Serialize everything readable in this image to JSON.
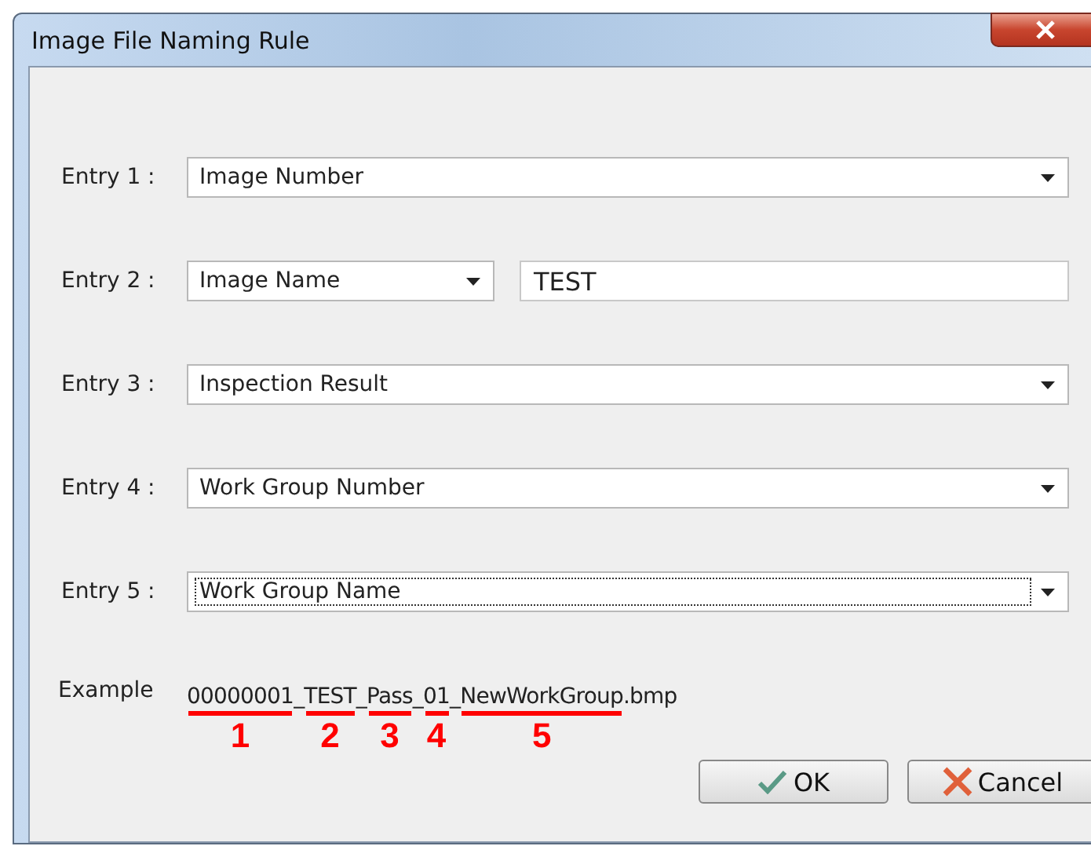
{
  "window": {
    "title": "Image File Naming Rule"
  },
  "entries": [
    {
      "label": "Entry 1 :",
      "value": "Image Number",
      "focused": false
    },
    {
      "label": "Entry 2 :",
      "value": "Image Name",
      "focused": false,
      "text": "TEST"
    },
    {
      "label": "Entry 3 :",
      "value": "Inspection Result",
      "focused": false
    },
    {
      "label": "Entry 4 :",
      "value": "Work Group Number",
      "focused": false
    },
    {
      "label": "Entry 5 :",
      "value": "Work Group Name",
      "focused": true
    }
  ],
  "example": {
    "label": "Example",
    "segments": [
      {
        "text": "00000001",
        "number": "1"
      },
      {
        "text": "_"
      },
      {
        "text": "TEST",
        "number": "2"
      },
      {
        "text": "_"
      },
      {
        "text": "Pass",
        "number": "3"
      },
      {
        "text": "_"
      },
      {
        "text": "01",
        "number": "4"
      },
      {
        "text": "_"
      },
      {
        "text": "NewWorkGroup",
        "number": "5"
      },
      {
        "text": ".bmp"
      }
    ]
  },
  "buttons": [
    {
      "label": "OK",
      "kind": "ok"
    },
    {
      "label": "Cancel",
      "kind": "cancel"
    }
  ]
}
